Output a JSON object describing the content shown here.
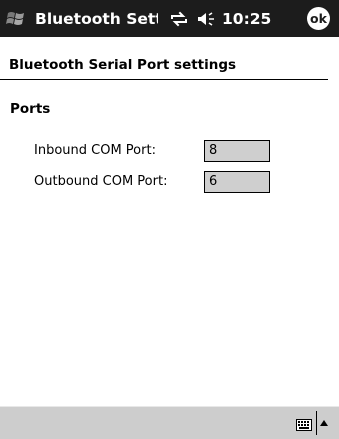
{
  "titlebar": {
    "title": "Bluetooth Settings",
    "time": "10:25",
    "ok_label": "ok",
    "icons": {
      "start": "windows-flag-icon",
      "connectivity": "connectivity-icon",
      "volume": "volume-icon"
    }
  },
  "header": {
    "title": "Bluetooth Serial Port settings"
  },
  "ports": {
    "heading": "Ports",
    "inbound_label": "Inbound COM Port:",
    "inbound_value": "8",
    "outbound_label": "Outbound COM Port:",
    "outbound_value": "6"
  },
  "bottombar": {
    "icons": {
      "keyboard": "keyboard-icon",
      "input_menu": "input-menu-arrow-icon"
    }
  },
  "colors": {
    "titlebar_bg": "#1c1c1c",
    "field_bg": "#cfcfcf",
    "bottombar_bg": "#cdcdcd"
  }
}
